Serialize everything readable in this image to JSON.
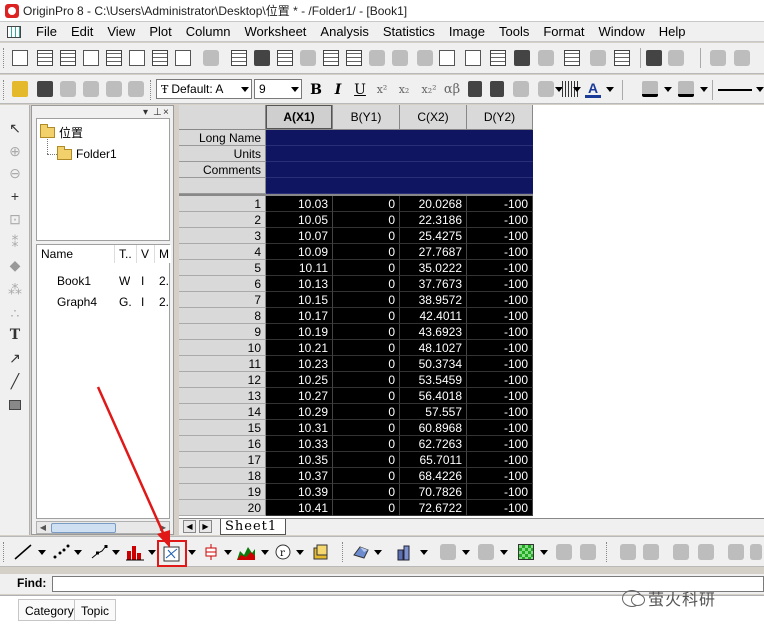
{
  "window": {
    "title": "OriginPro 8 - C:\\Users\\Administrator\\Desktop\\位置 * - /Folder1/ - [Book1]"
  },
  "menu": [
    "File",
    "Edit",
    "View",
    "Plot",
    "Column",
    "Worksheet",
    "Analysis",
    "Statistics",
    "Image",
    "Tools",
    "Format",
    "Window",
    "Help"
  ],
  "format_toolbar": {
    "font_value": "Default: A",
    "font_size": "9",
    "bold": "B",
    "italic": "I",
    "underline": "U",
    "superscript": "x²",
    "subscript": "x₂",
    "supsub": "x₂²",
    "greek": "αβ"
  },
  "explorer": {
    "root_folder": "位置",
    "child_folder": "Folder1",
    "columns": [
      "Name",
      "T..",
      "V",
      "M"
    ],
    "items": [
      {
        "name": "Book1",
        "type": "W",
        "view": "I",
        "modified": "2."
      },
      {
        "name": "Graph4",
        "type": "G.",
        "view": "I",
        "modified": "2."
      }
    ]
  },
  "worksheet": {
    "columns": [
      "A(X1)",
      "B(Y1)",
      "C(X2)",
      "D(Y2)"
    ],
    "label_rows": [
      "Long Name",
      "Units",
      "Comments"
    ],
    "rows": [
      {
        "n": "1",
        "a": "10.03",
        "b": "0",
        "c": "20.0268",
        "d": "-100"
      },
      {
        "n": "2",
        "a": "10.05",
        "b": "0",
        "c": "22.3186",
        "d": "-100"
      },
      {
        "n": "3",
        "a": "10.07",
        "b": "0",
        "c": "25.4275",
        "d": "-100"
      },
      {
        "n": "4",
        "a": "10.09",
        "b": "0",
        "c": "27.7687",
        "d": "-100"
      },
      {
        "n": "5",
        "a": "10.11",
        "b": "0",
        "c": "35.0222",
        "d": "-100"
      },
      {
        "n": "6",
        "a": "10.13",
        "b": "0",
        "c": "37.7673",
        "d": "-100"
      },
      {
        "n": "7",
        "a": "10.15",
        "b": "0",
        "c": "38.9572",
        "d": "-100"
      },
      {
        "n": "8",
        "a": "10.17",
        "b": "0",
        "c": "42.4011",
        "d": "-100"
      },
      {
        "n": "9",
        "a": "10.19",
        "b": "0",
        "c": "43.6923",
        "d": "-100"
      },
      {
        "n": "10",
        "a": "10.21",
        "b": "0",
        "c": "48.1027",
        "d": "-100"
      },
      {
        "n": "11",
        "a": "10.23",
        "b": "0",
        "c": "50.3734",
        "d": "-100"
      },
      {
        "n": "12",
        "a": "10.25",
        "b": "0",
        "c": "53.5459",
        "d": "-100"
      },
      {
        "n": "13",
        "a": "10.27",
        "b": "0",
        "c": "56.4018",
        "d": "-100"
      },
      {
        "n": "14",
        "a": "10.29",
        "b": "0",
        "c": "57.557",
        "d": "-100"
      },
      {
        "n": "15",
        "a": "10.31",
        "b": "0",
        "c": "60.8968",
        "d": "-100"
      },
      {
        "n": "16",
        "a": "10.33",
        "b": "0",
        "c": "62.7263",
        "d": "-100"
      },
      {
        "n": "17",
        "a": "10.35",
        "b": "0",
        "c": "65.7011",
        "d": "-100"
      },
      {
        "n": "18",
        "a": "10.37",
        "b": "0",
        "c": "68.4226",
        "d": "-100"
      },
      {
        "n": "19",
        "a": "10.39",
        "b": "0",
        "c": "70.7826",
        "d": "-100"
      },
      {
        "n": "20",
        "a": "10.41",
        "b": "0",
        "c": "72.6722",
        "d": "-100"
      }
    ],
    "sheet_tab": "Sheet1"
  },
  "find": {
    "label": "Find:",
    "value": ""
  },
  "results": {
    "columns": [
      "Category",
      "Topic"
    ]
  },
  "watermark": {
    "text": "萤火科研"
  },
  "colors": {
    "label_band": "#0f1560",
    "cell_bg": "#000000",
    "highlight": "#e01818"
  }
}
